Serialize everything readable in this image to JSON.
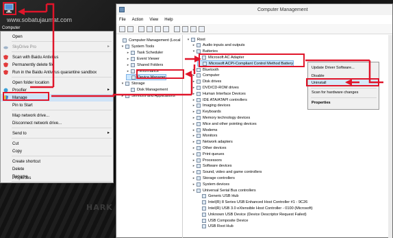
{
  "watermark": "www.sobatujaumat.com",
  "desktop_icon": {
    "label": "Computer",
    "icon": "computer-icon"
  },
  "desktop_text": "HARK",
  "context_menu": {
    "items": [
      {
        "label": "Open",
        "icon": "",
        "submenu": false
      },
      {
        "label": "SkyDrive Pro",
        "icon": "skydrive-icon",
        "submenu": true,
        "disabled": true
      },
      {
        "label": "Scan with Baidu Antivirus",
        "icon": "baidu-antivirus-icon",
        "submenu": false
      },
      {
        "label": "Permanently delete file",
        "icon": "baidu-antivirus-icon",
        "submenu": false
      },
      {
        "label": "Run in the Baidu Antivirus quarantine sandbox",
        "icon": "baidu-antivirus-icon",
        "submenu": false
      },
      {
        "label": "Open folder location",
        "icon": "",
        "submenu": false
      },
      {
        "label": "Proofier",
        "icon": "proofier-icon",
        "submenu": true
      },
      {
        "label": "Manage",
        "icon": "shield-icon",
        "submenu": false
      },
      {
        "label": "Pin to Start",
        "icon": "",
        "submenu": false
      },
      {
        "label": "Map network drive...",
        "icon": "",
        "submenu": false
      },
      {
        "label": "Disconnect network drive...",
        "icon": "",
        "submenu": false
      },
      {
        "label": "Send to",
        "icon": "",
        "submenu": true
      },
      {
        "label": "Cut",
        "icon": "",
        "submenu": false
      },
      {
        "label": "Copy",
        "icon": "",
        "submenu": false
      },
      {
        "label": "Create shortcut",
        "icon": "",
        "submenu": false
      },
      {
        "label": "Delete",
        "icon": "",
        "submenu": false
      },
      {
        "label": "Rename",
        "icon": "",
        "submenu": false
      },
      {
        "label": "Properties",
        "icon": "",
        "submenu": false
      }
    ]
  },
  "window": {
    "title": "Computer Management",
    "menu": [
      "File",
      "Action",
      "View",
      "Help"
    ],
    "left_tree": [
      {
        "label": "Computer Management (Local",
        "expander": ""
      },
      {
        "label": "System Tools",
        "expander": "▾"
      },
      {
        "label": "Task Scheduler",
        "expander": "▸"
      },
      {
        "label": "Event Viewer",
        "expander": "▸"
      },
      {
        "label": "Shared Folders",
        "expander": "▸"
      },
      {
        "label": "Performance",
        "expander": "▸"
      },
      {
        "label": "Device Manager",
        "expander": ""
      },
      {
        "label": "Storage",
        "expander": "▾"
      },
      {
        "label": "Disk Management",
        "expander": ""
      },
      {
        "label": "Services and Applications",
        "expander": "▸"
      }
    ],
    "right_tree": [
      {
        "label": "Root",
        "expander": "▾"
      },
      {
        "label": "Audio inputs and outputs",
        "expander": "▸"
      },
      {
        "label": "Batteries",
        "expander": "▾"
      },
      {
        "label": "Microsoft AC Adapter",
        "expander": ""
      },
      {
        "label": "Microsoft ACPI-Compliant Control Method Battery",
        "expander": ""
      },
      {
        "label": "Bluetooth",
        "expander": "▸"
      },
      {
        "label": "Computer",
        "expander": "▸"
      },
      {
        "label": "Disk drives",
        "expander": "▸"
      },
      {
        "label": "DVD/CD-ROM drives",
        "expander": "▸"
      },
      {
        "label": "Human Interface Devices",
        "expander": "▸"
      },
      {
        "label": "IDE ATA/ATAPI controllers",
        "expander": "▸"
      },
      {
        "label": "Imaging devices",
        "expander": "▸"
      },
      {
        "label": "Keyboards",
        "expander": "▸"
      },
      {
        "label": "Memory technology devices",
        "expander": "▸"
      },
      {
        "label": "Mice and other pointing devices",
        "expander": "▸"
      },
      {
        "label": "Modems",
        "expander": "▸"
      },
      {
        "label": "Monitors",
        "expander": "▸"
      },
      {
        "label": "Network adapters",
        "expander": "▸"
      },
      {
        "label": "Other devices",
        "expander": "▸"
      },
      {
        "label": "Print queues",
        "expander": "▸"
      },
      {
        "label": "Processors",
        "expander": "▸"
      },
      {
        "label": "Software devices",
        "expander": "▸"
      },
      {
        "label": "Sound, video and game controllers",
        "expander": "▸"
      },
      {
        "label": "Storage controllers",
        "expander": "▸"
      },
      {
        "label": "System devices",
        "expander": "▸"
      },
      {
        "label": "Universal Serial Bus controllers",
        "expander": "▾"
      },
      {
        "label": "Generic USB Hub",
        "expander": ""
      },
      {
        "label": "Intel(R) 8 Series USB Enhanced Host Controller #1 - 9C26",
        "expander": ""
      },
      {
        "label": "Intel(R) USB 3.0 eXtensible Host Controller - 0100 (Microsoft)",
        "expander": ""
      },
      {
        "label": "Unknown USB Device (Device Descriptor Request Failed)",
        "expander": ""
      },
      {
        "label": "USB Composite Device",
        "expander": ""
      },
      {
        "label": "USB Root Hub",
        "expander": ""
      }
    ]
  },
  "device_menu": {
    "items": [
      "Update Driver Software...",
      "Disable",
      "Uninstall",
      "Scan for hardware changes",
      "Properties"
    ]
  },
  "colors": {
    "annotation_red": "#e0152a",
    "selection_blue": "#cde8ff",
    "menu_bg": "#f0f0f0"
  }
}
